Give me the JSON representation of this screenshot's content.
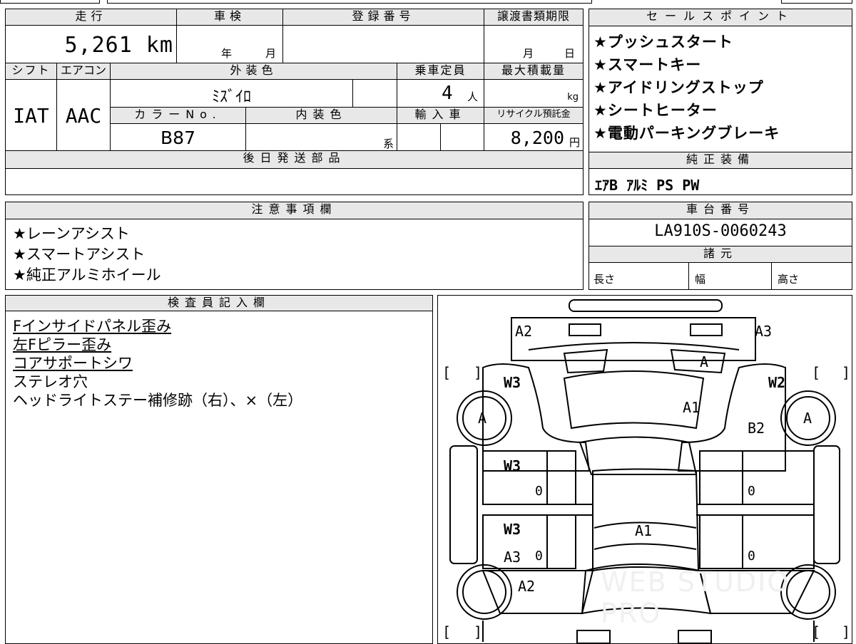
{
  "main_table": {
    "h_mileage": "走行",
    "mileage": "5,261 km",
    "h_inspection": "車検",
    "inspection_year": "年",
    "inspection_month": "月",
    "h_reg_no": "登録番号",
    "h_transfer_deadline": "譲渡書類期限",
    "transfer_month": "月",
    "transfer_day": "日",
    "h_shift": "シフト",
    "shift": "IAT",
    "h_aircon": "エアコン",
    "aircon": "AAC",
    "h_exterior": "外装色",
    "exterior": "ﾐｽﾞｲﾛ",
    "h_capacity": "乗車定員",
    "capacity": "4",
    "capacity_unit": "人",
    "h_max_load": "最大積載量",
    "max_load_unit": "kg",
    "h_color_no": "カラーNo.",
    "color_no": "B87",
    "h_interior": "内装色",
    "interior_suffix": "系",
    "h_import": "輸入車",
    "h_recycle": "リサイクル預託金",
    "recycle": "8,200",
    "recycle_unit": "円",
    "h_later_parts": "後日発送部品"
  },
  "sales_points": {
    "title": "セールスポイント",
    "items": [
      "★プッシュスタート",
      "★スマートキー",
      "★アイドリングストップ",
      "★シートヒーター",
      "★電動パーキングブレーキ"
    ]
  },
  "genuine_equipment": {
    "title": "純正装備",
    "value": "ｴｱB ｱﾙﾐ PS PW"
  },
  "caution": {
    "title": "注意事項欄",
    "items": [
      "★レーンアシスト",
      "★スマートアシスト",
      "★純正アルミホイール"
    ]
  },
  "chassis": {
    "title": "車台番号",
    "value": "LA910S-0060243"
  },
  "specs": {
    "title": "諸元",
    "length": "長さ",
    "width": "幅",
    "height": "高さ"
  },
  "inspector": {
    "title": "検査員記入欄",
    "items": [
      {
        "text": "Fインサイドパネル歪み",
        "underline": true
      },
      {
        "text": "左Fピラー歪み",
        "underline": true
      },
      {
        "text": "コアサポートシワ",
        "underline": true
      },
      {
        "text": "ステレオ穴",
        "underline": false
      },
      {
        "text": "ヘッドライトステー補修跡（右）、×（左）",
        "underline": false
      }
    ]
  },
  "diagram": {
    "labels": {
      "a2_front": "A2",
      "a3_front": "A3",
      "a_hood": "A",
      "w3_front_left": "W3",
      "w2_front_right": "W2",
      "a1_hood": "A1",
      "a_tire_left": "A",
      "a_tire_right": "A",
      "b2_right": "B2",
      "w3_door_left_front": "W3",
      "zero_1": "0",
      "zero_2": "0",
      "w3_door_left_rear": "W3",
      "a3_left_rear": "A3",
      "zero_3": "0",
      "zero_4": "0",
      "a1_roof": "A1",
      "a2_rear": "A2",
      "bracket_l1": "[",
      "bracket_r1": "]",
      "bracket_l2": "[",
      "bracket_r2": "]",
      "bracket_l3": "[",
      "bracket_r3": "]",
      "bracket_l4": "[",
      "bracket_r4": "]"
    },
    "watermark": "WEB STUDIO PRO"
  }
}
